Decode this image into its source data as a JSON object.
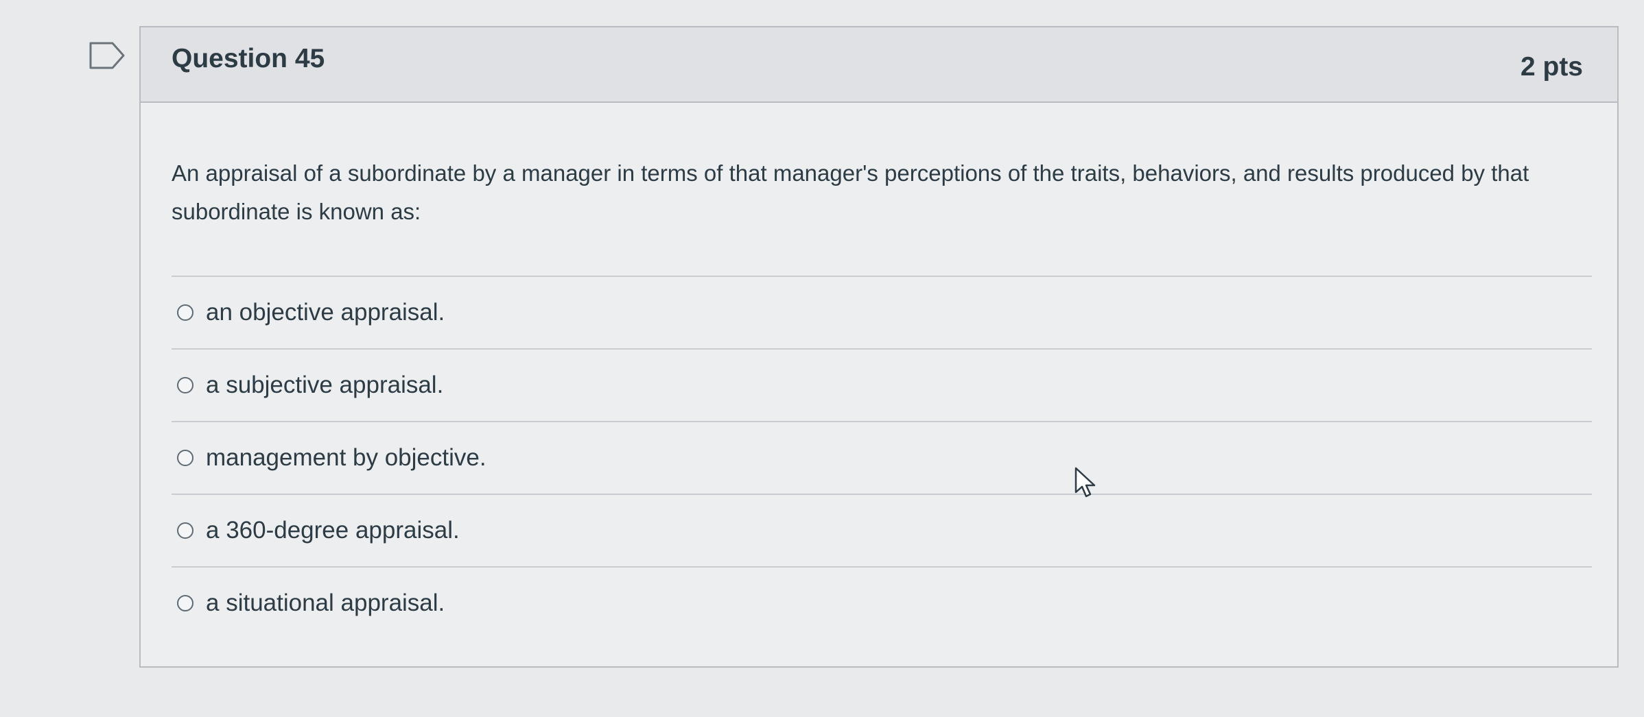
{
  "question": {
    "title": "Question 45",
    "points": "2 pts",
    "text": "An appraisal of a subordinate by a manager in terms of that manager's perceptions of the traits, behaviors, and results produced by that subordinate is known as:",
    "answers": [
      {
        "label": "an objective appraisal.",
        "selected": false
      },
      {
        "label": "a subjective appraisal.",
        "selected": false
      },
      {
        "label": "management by objective.",
        "selected": false
      },
      {
        "label": "a 360-degree appraisal.",
        "selected": false
      },
      {
        "label": "a situational appraisal.",
        "selected": false
      }
    ]
  },
  "icons": {
    "flag": "flag-question-icon",
    "cursor": "mouse-pointer-icon"
  },
  "colors": {
    "text": "#2d3b45",
    "border": "#b8bcc1",
    "header_bg": "#dfe1e4",
    "page_bg": "#e9eaec"
  }
}
